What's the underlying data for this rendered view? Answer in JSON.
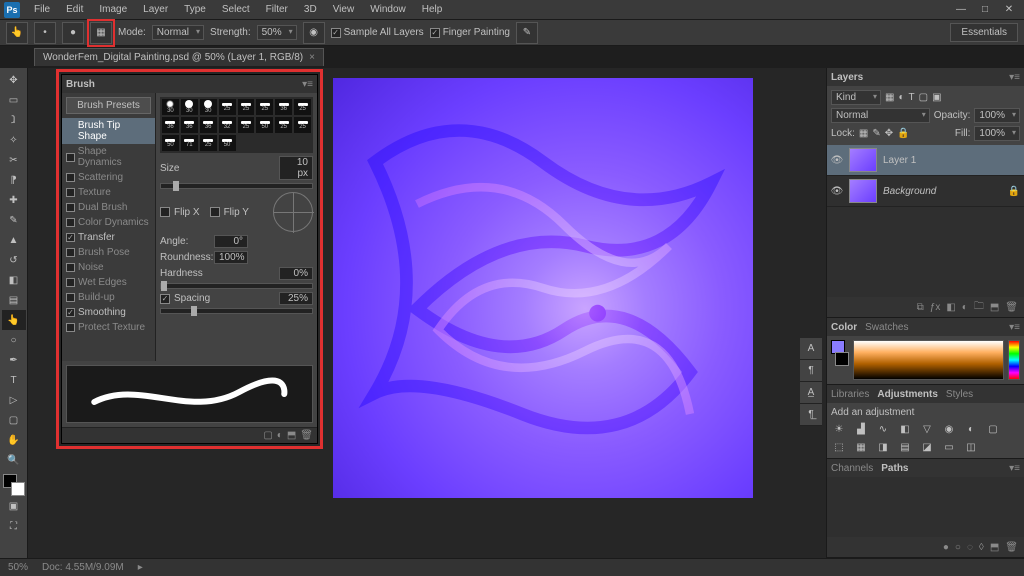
{
  "menu": [
    "File",
    "Edit",
    "Image",
    "Layer",
    "Type",
    "Select",
    "Filter",
    "3D",
    "View",
    "Window",
    "Help"
  ],
  "options": {
    "mode_label": "Mode:",
    "mode_value": "Normal",
    "strength_label": "Strength:",
    "strength_value": "50%",
    "sample_all": "Sample All Layers",
    "finger": "Finger Painting"
  },
  "workspace_label": "Essentials",
  "document_tab": "WonderFem_Digital Painting.psd @ 50% (Layer 1, RGB/8)",
  "brush_panel": {
    "title": "Brush",
    "presets_btn": "Brush Presets",
    "items": [
      {
        "label": "Brush Tip Shape",
        "checked": null,
        "selected": true
      },
      {
        "label": "Shape Dynamics",
        "checked": false
      },
      {
        "label": "Scattering",
        "checked": false
      },
      {
        "label": "Texture",
        "checked": false
      },
      {
        "label": "Dual Brush",
        "checked": false
      },
      {
        "label": "Color Dynamics",
        "checked": false
      },
      {
        "label": "Transfer",
        "checked": true
      },
      {
        "label": "Brush Pose",
        "checked": false
      },
      {
        "label": "Noise",
        "checked": false
      },
      {
        "label": "Wet Edges",
        "checked": false
      },
      {
        "label": "Build-up",
        "checked": false
      },
      {
        "label": "Smoothing",
        "checked": true
      },
      {
        "label": "Protect Texture",
        "checked": false
      }
    ],
    "tip_sizes": [
      "30",
      "30",
      "30",
      "25",
      "25",
      "25",
      "36",
      "25",
      "36",
      "36",
      "36",
      "32",
      "25",
      "50",
      "25",
      "25",
      "50",
      "71",
      "25",
      "50"
    ],
    "size_label": "Size",
    "size_value": "10 px",
    "flipx": "Flip X",
    "flipy": "Flip Y",
    "angle_label": "Angle:",
    "angle_value": "0°",
    "roundness_label": "Roundness:",
    "roundness_value": "100%",
    "hardness_label": "Hardness",
    "hardness_value": "0%",
    "spacing_label": "Spacing",
    "spacing_value": "25%"
  },
  "layers": {
    "tab": "Layers",
    "kind": "Kind",
    "blend": "Normal",
    "opacity_label": "Opacity:",
    "opacity_value": "100%",
    "lock_label": "Lock:",
    "fill_label": "Fill:",
    "fill_value": "100%",
    "items": [
      {
        "name": "Layer 1",
        "selected": true,
        "italic": false
      },
      {
        "name": "Background",
        "selected": false,
        "italic": true
      }
    ]
  },
  "color": {
    "tab1": "Color",
    "tab2": "Swatches"
  },
  "adjust": {
    "tabs": [
      "Libraries",
      "Adjustments",
      "Styles"
    ],
    "heading": "Add an adjustment"
  },
  "paths": {
    "tab1": "Channels",
    "tab2": "Paths"
  },
  "status": {
    "zoom": "50%",
    "doc": "Doc: 4.55M/9.09M"
  }
}
